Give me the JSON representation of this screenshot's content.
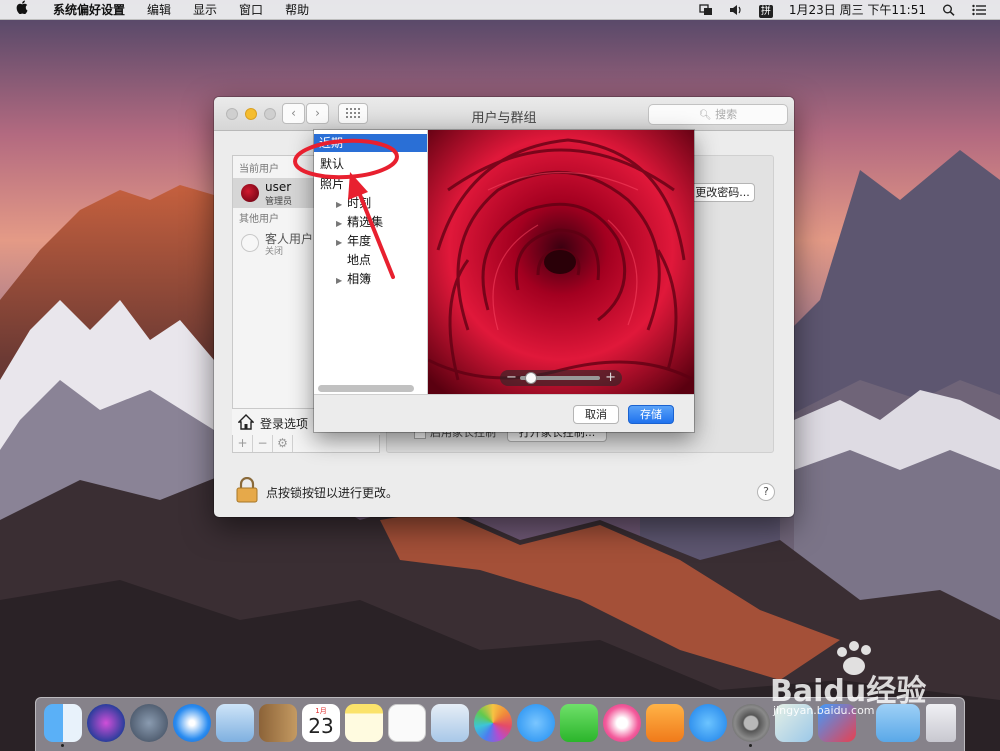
{
  "menubar": {
    "app_name": "系统偏好设置",
    "menus": [
      "编辑",
      "显示",
      "窗口",
      "帮助"
    ],
    "input_method": "拼",
    "datetime": "1月23日 周三 下午11:51"
  },
  "window": {
    "title": "用户与群组",
    "search_placeholder": "搜索",
    "current_users_label": "当前用户",
    "current_user": {
      "name": "user",
      "role": "管理员"
    },
    "other_users_label": "其他用户",
    "guest_user": {
      "name": "客人用户",
      "status": "关闭"
    },
    "login_options_label": "登录选项",
    "change_password_label": "更改密码...",
    "parental_checkbox_label": "启用家长控制",
    "parental_button_label": "打开家长控制...",
    "lock_text": "点按锁按钮以进行更改。",
    "help_label": "?"
  },
  "picker": {
    "selected_item_label": "近期",
    "sources": [
      {
        "label": "默认",
        "expandable": false
      },
      {
        "label": "照片",
        "expandable": false
      },
      {
        "label": "时刻",
        "expandable": true
      },
      {
        "label": "精选集",
        "expandable": true
      },
      {
        "label": "年度",
        "expandable": true
      },
      {
        "label": "地点",
        "expandable": false
      },
      {
        "label": "相簿",
        "expandable": true
      }
    ],
    "cancel_label": "取消",
    "save_label": "存储",
    "zoom_level": 0.1
  },
  "dock": {
    "calendar_month": "1月",
    "calendar_day": "23",
    "apps": [
      "finder-icon",
      "siri-icon",
      "launchpad-icon",
      "safari-icon",
      "mail-icon",
      "contacts-icon",
      "calendar-icon",
      "notes-icon",
      "reminders-icon",
      "preview-icon",
      "photos-icon",
      "messages-icon",
      "facetime-icon",
      "itunes-icon",
      "ibooks-icon",
      "appstore-icon",
      "system-preferences-icon",
      "maps-icon",
      "downloads-icon",
      "trash-icon"
    ]
  },
  "watermark": {
    "brand": "Baidu经验",
    "url": "jingyan.baidu.com"
  },
  "colors": {
    "selection_blue": "#2a6fd6",
    "annotation_red": "#e8202f",
    "save_button": "#1f72ee"
  }
}
